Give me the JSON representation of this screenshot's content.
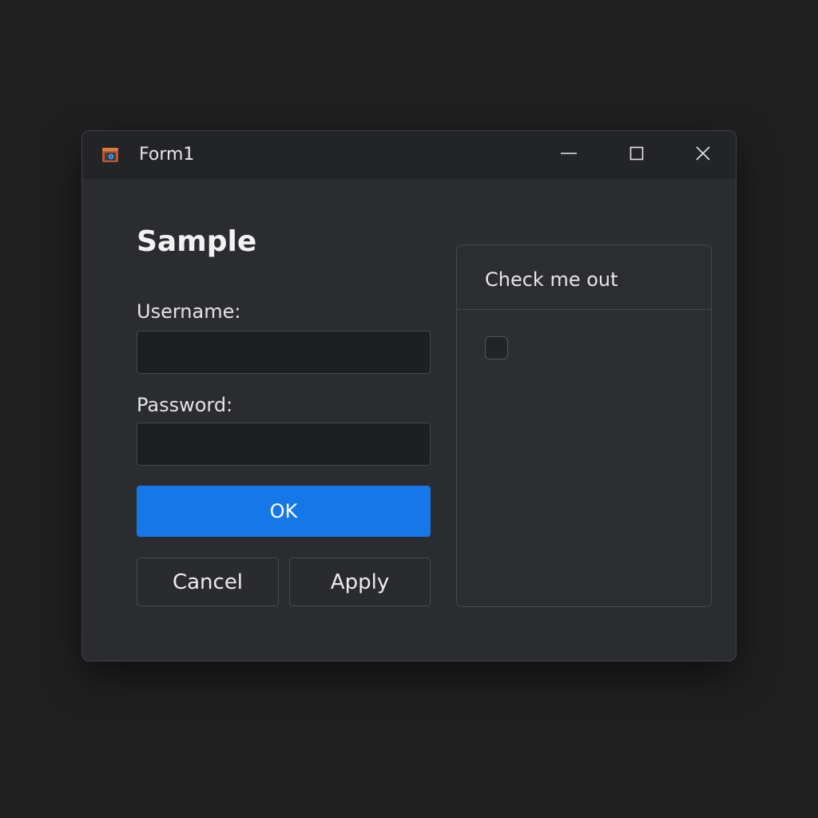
{
  "window": {
    "title": "Form1",
    "icon": "app-form-icon",
    "controls": {
      "minimize_icon": "minimize-icon",
      "maximize_icon": "maximize-icon",
      "close_icon": "close-icon"
    }
  },
  "form": {
    "heading": "Sample",
    "username": {
      "label": "Username:",
      "value": "",
      "placeholder": ""
    },
    "password": {
      "label": "Password:",
      "value": "",
      "placeholder": ""
    },
    "ok_label": "OK",
    "cancel_label": "Cancel",
    "apply_label": "Apply"
  },
  "group": {
    "title": "Check me out",
    "checkbox_checked": false
  },
  "colors": {
    "accent": "#1677e8",
    "window_bg": "#2b2c30",
    "titlebar_bg": "#232428",
    "desktop_bg": "#202020"
  }
}
